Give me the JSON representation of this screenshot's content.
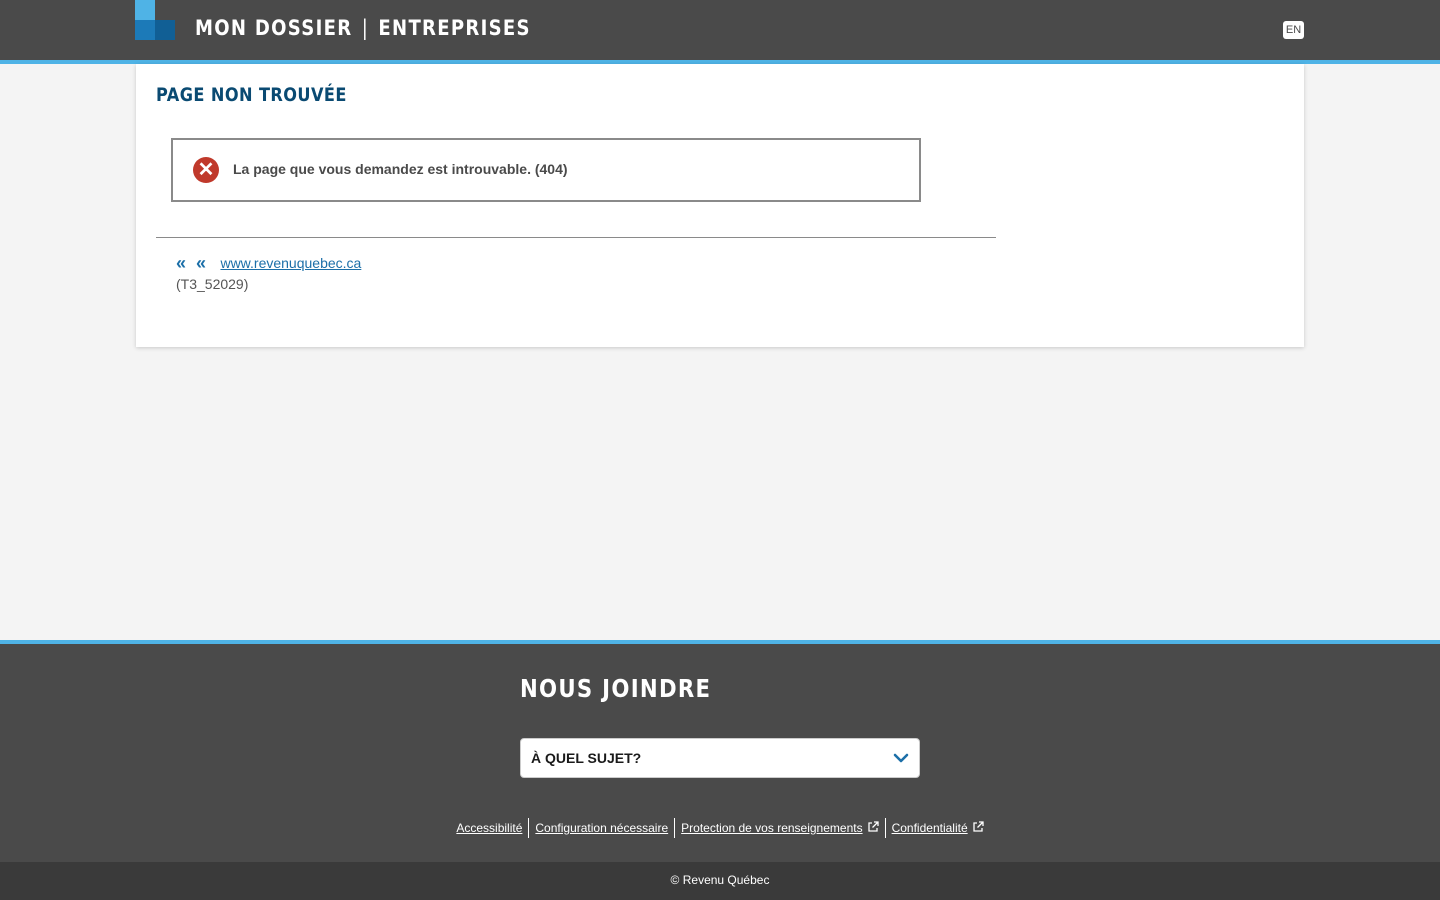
{
  "header": {
    "brand_left": "MON DOSSIER",
    "brand_separator": "|",
    "brand_right": "ENTREPRISES",
    "language_toggle": "EN"
  },
  "main": {
    "title": "PAGE NON TROUVÉE",
    "alert": {
      "icon": "error-x-icon",
      "message": "La page que vous demandez est introuvable. (404)"
    },
    "back_link": {
      "icon": "double-chevron-left-icon",
      "label": "www.revenuquebec.ca"
    },
    "code": "(T3_52029)"
  },
  "footer": {
    "title": "NOUS JOINDRE",
    "topic_select": {
      "selected": "À QUEL SUJET?",
      "icon": "chevron-down-icon"
    },
    "links": [
      {
        "label": "Accessibilité",
        "external": false
      },
      {
        "label": "Configuration nécessaire",
        "external": false
      },
      {
        "label": "Protection de vos renseignements",
        "external": true
      },
      {
        "label": "Confidentialité",
        "external": true
      }
    ],
    "copyright": "© Revenu Québec"
  },
  "colors": {
    "header_bg": "#4a4a4a",
    "accent": "#4fb3e6",
    "title": "#0a4a72",
    "link": "#1c6fa8",
    "error": "#c0392b"
  }
}
